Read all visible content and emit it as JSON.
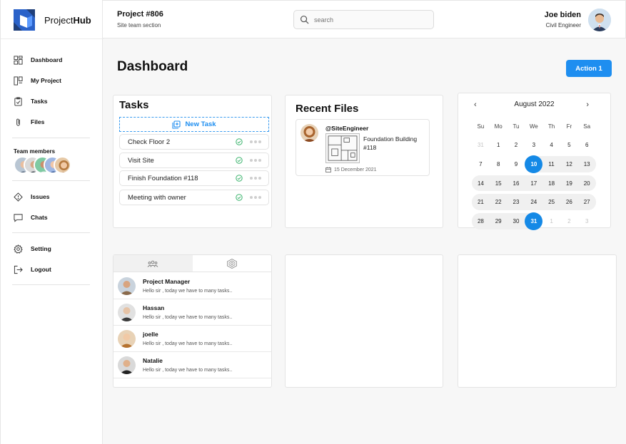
{
  "brand": {
    "name_plain": "Project",
    "name_bold": "Hub"
  },
  "header": {
    "project_title": "Project #806",
    "project_subtitle": "Site team section",
    "search_placeholder": "search",
    "user_name": "Joe biden",
    "user_role": "Civil Engineer"
  },
  "sidebar": {
    "items": [
      {
        "label": "Dashboard",
        "icon": "dashboard-icon"
      },
      {
        "label": "My Project",
        "icon": "project-icon"
      },
      {
        "label": "Tasks",
        "icon": "clipboard-icon"
      },
      {
        "label": "Files",
        "icon": "paperclip-icon"
      }
    ],
    "team_label": "Team members",
    "items2": [
      {
        "label": "Issues",
        "icon": "diamond-alert-icon"
      },
      {
        "label": "Chats",
        "icon": "chat-bubble-icon"
      }
    ],
    "items3": [
      {
        "label": "Setting",
        "icon": "gear-icon"
      },
      {
        "label": "Logout",
        "icon": "logout-icon"
      }
    ]
  },
  "main": {
    "title": "Dashboard",
    "action_label": "Action 1"
  },
  "tasks": {
    "title": "Tasks",
    "new_task_label": "New Task",
    "items": [
      "Check Floor 2",
      "Visit Site",
      "Finish Foundation #118",
      "Meeting with owner"
    ]
  },
  "recent_files": {
    "title": "Recent Files",
    "handle": "@SiteEngineer",
    "file_name": "Foundation Building #118",
    "date": "15 December 2021"
  },
  "calendar": {
    "month_label": "August 2022",
    "weekdays": [
      "Su",
      "Mo",
      "Tu",
      "We",
      "Th",
      "Fr",
      "Sa"
    ],
    "weeks": [
      [
        "31",
        "1",
        "2",
        "3",
        "4",
        "5",
        "6"
      ],
      [
        "7",
        "8",
        "9",
        "10",
        "11",
        "12",
        "13"
      ],
      [
        "14",
        "15",
        "16",
        "17",
        "18",
        "19",
        "20"
      ],
      [
        "21",
        "22",
        "23",
        "24",
        "25",
        "26",
        "27"
      ],
      [
        "28",
        "29",
        "30",
        "31",
        "1",
        "2",
        "3"
      ]
    ],
    "range_start": "10",
    "range_end": "31"
  },
  "chats": {
    "items": [
      {
        "name": "Project Manager",
        "message": "Hello sir , today we have to many tasks.."
      },
      {
        "name": "Hassan",
        "message": "Hello sir , today we have to many tasks.."
      },
      {
        "name": "joelle",
        "message": "Hello sir , today we have to many tasks.."
      },
      {
        "name": "Natalie",
        "message": "Hello sir , today we have to many tasks.."
      }
    ]
  },
  "colors": {
    "accent": "#1e8ef0",
    "success": "#3cb46e",
    "range_band": "#f0f0f0"
  }
}
